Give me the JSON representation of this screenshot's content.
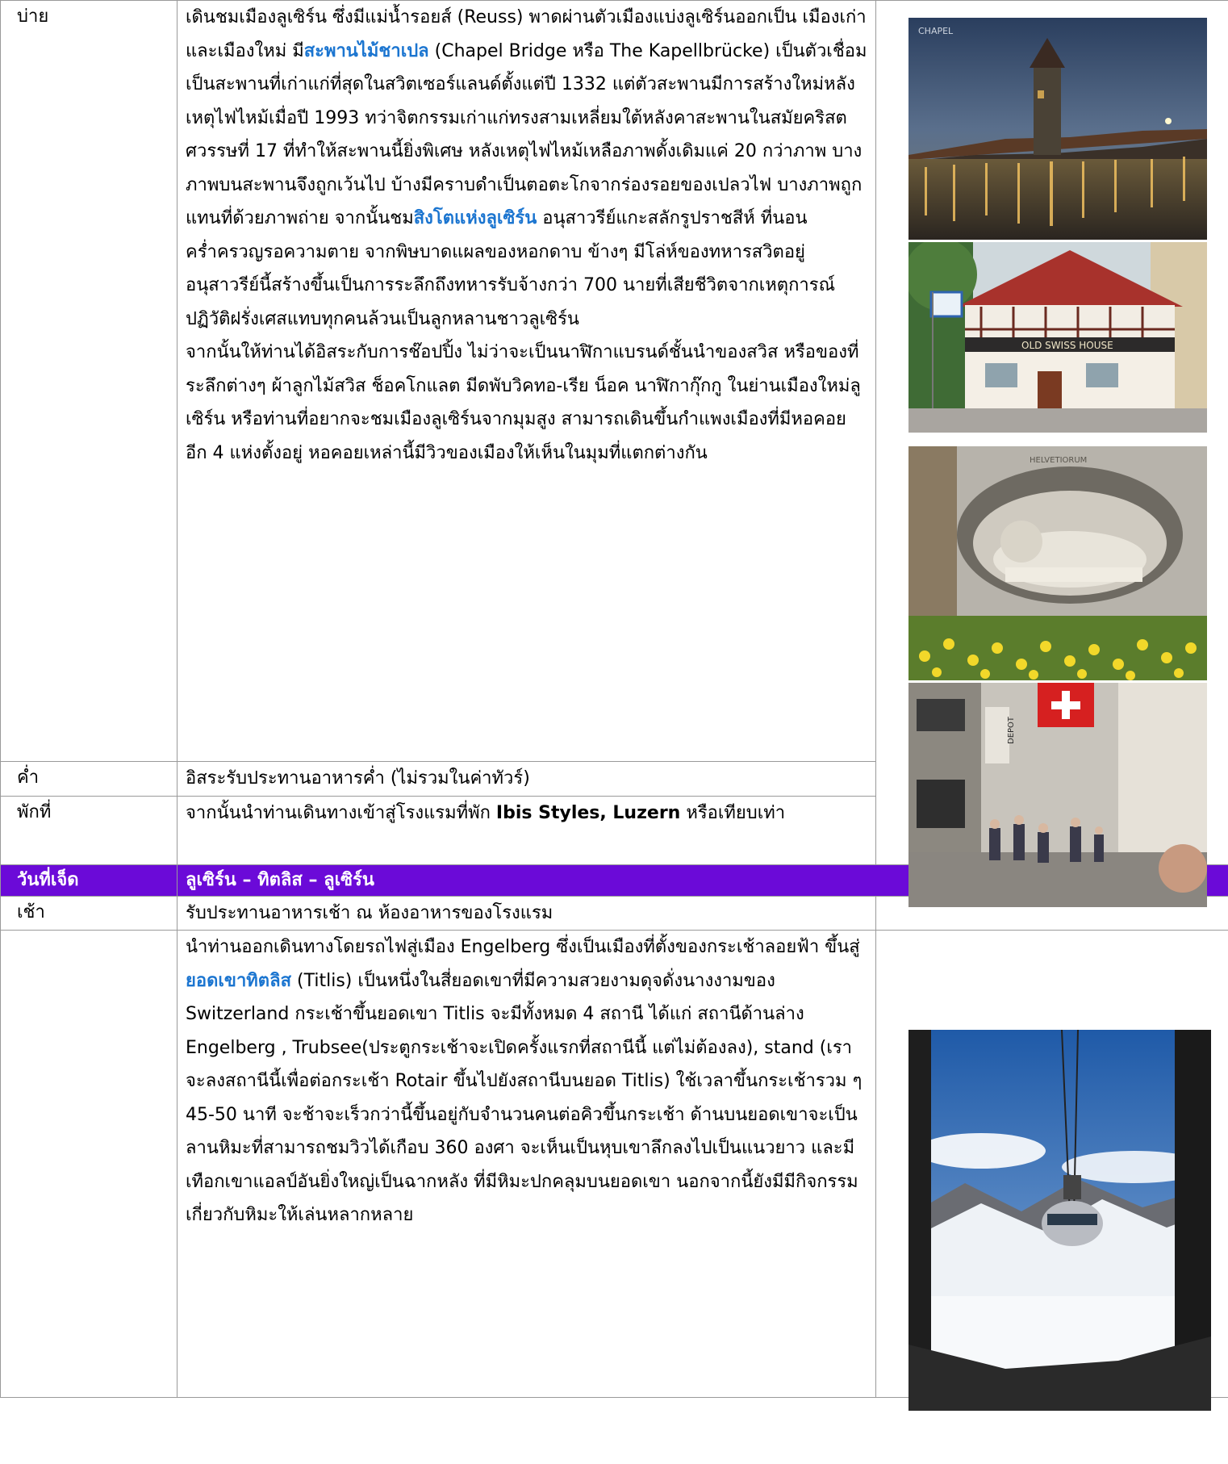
{
  "rows": {
    "afternoon": {
      "label": "บ่าย",
      "p1": [
        "เดินชมเมืองลูเซิร์น ซึ่งมีแม่น้ำรอยส์ (Reuss) พาดผ่านตัวเมืองแบ่งลูเซิร์นออกเป็น เมืองเก่าและเมืองใหม่ มี",
        "สะพานไม้ชาเปล",
        " (Chapel Bridge หรือ The Kapellbrücke) เป็นตัวเชื่อม เป็นสะพานที่เก่าแก่ที่สุดในสวิตเซอร์แลนด์ตั้งแต่ปี 1332 แต่ตัวสะพานมีการสร้างใหม่หลังเหตุไฟไหม้เมื่อปี 1993 ทว่าจิตกรรมเก่าแก่ทรงสามเหลี่ยมใต้หลังคาสะพานในสมัยคริสตศวรรษที่ 17 ที่ทำให้สะพานนี้ยิ่งพิเศษ หลังเหตุไฟไหม้เหลือภาพดั้งเดิมแค่ 20 กว่าภาพ บางภาพบนสะพานจึงถูกเว้นไป บ้างมีคราบดำเป็นตอตะโกจากร่องรอยของเปลวไฟ บางภาพถูกแทนที่ด้วยภาพถ่าย จากนั้นชม",
        "สิงโตแห่งลูเซิร์น",
        " อนุสาวรีย์แกะสลักรูปราชสีห์ ที่นอนคร่ำครวญรอความตาย จากพิษบาดแผลของหอกดาบ ข้างๆ มีโล่ห์ของทหารสวิตอยู่  อนุสาวรีย์นี้สร้างขึ้นเป็นการระลึกถึงทหารรับจ้างกว่า 700 นายที่เสียชีวิตจากเหตุการณ์ปฏิวัติฝรั่งเศสแทบทุกคนล้วนเป็นลูกหลานชาวลูเซิร์น"
      ],
      "p2": "จากนั้นให้ท่านได้อิสระกับการช๊อปปิ้ง ไม่ว่าจะเป็นนาฬิกาแบรนด์ชั้นนำของสวิส หรือของที่ระลึกต่างๆ ผ้าลูกไม้สวิส ช็อคโกแลต มีดพับวิคทอ-เรีย น็อค  นาฬิกากุ๊กกู ในย่านเมืองใหม่ลูเซิร์น หรือท่านที่อยากจะชมเมืองลูเซิร์นจากมุมสูง สามารถเดินขึ้นกำแพงเมืองที่มีหอคอยอีก 4 แห่งตั้งอยู่ หอคอยเหล่านี้มีวิวของเมืองให้เห็นในมุมที่แตกต่างกัน"
    },
    "dinner": {
      "label": "ค่ำ",
      "text": "อิสระรับประทานอาหารค่ำ (ไม่รวมในค่าทัวร์)"
    },
    "hotel": {
      "label": "พักที่",
      "pre": "จากนั้นนำท่านเดินทางเข้าสู่โรงแรมที่พัก ",
      "bold": "Ibis Styles, Luzern",
      "post": " หรือเทียบเท่า"
    },
    "day7": {
      "label": "วันที่เจ็ด",
      "title": "ลูเซิร์น – ทิตลิส – ลูเซิร์น"
    },
    "morning": {
      "label": "เช้า",
      "text": "รับประทานอาหารเช้า ณ ห้องอาหารของโรงแรม"
    },
    "titlis": {
      "label": "",
      "pre": "นำท่านออกเดินทางโดยรถไฟสู่เมือง Engelberg ซึ่งเป็นเมืองที่ตั้งของกระเช้าลอยฟ้า ขึ้นสู่",
      "link": "ยอดเขาทิตลิส",
      "post": " (Titlis) เป็นหนึ่งในสี่ยอดเขาที่มีความสวยงามดุจดั่งนางงามของ Switzerland กระเช้าขึ้นยอดเขา Titlis จะมีทั้งหมด 4 สถานี ได้แก่ สถานีด้านล่าง Engelberg , Trubsee(ประตูกระเช้าจะเปิดครั้งแรกที่สถานีนี้ แต่ไม่ต้องลง), stand (เราจะลงสถานีนี้เพื่อต่อกระเช้า Rotair ขึ้นไปยังสถานีบนยอด Titlis) ใช้เวลาขึ้นกระเช้ารวม ๆ 45-50 นาที จะช้าจะเร็วกว่านี้ขึ้นอยู่กับจำนวนคนต่อคิวขึ้นกระเช้า ด้านบนยอดเขาจะเป็นลานหิมะที่สามารถชมวิวได้เกือบ 360 องศา จะเห็นเป็นหุบเขาลึกลงไปเป็นแนวยาว และมีเทือกเขาแอลป์อันยิ่งใหญ่เป็นฉากหลัง ที่มีหิมะปกคลุมบนยอดเขา นอกจากนี้ยังมีมีกิจกรรมเกี่ยวกับหิมะให้เล่นหลากหลาย"
    }
  },
  "photos": {
    "chapel_sign": "CHAPEL",
    "house_sign": "OLD SWISS HOUSE",
    "lion_sign": "HELVETIORUM",
    "street_sign": "DEPOT"
  },
  "colors": {
    "day_header_bg": "#6b0ad8",
    "link": "#1b75d0",
    "border": "#9a9a9a"
  }
}
